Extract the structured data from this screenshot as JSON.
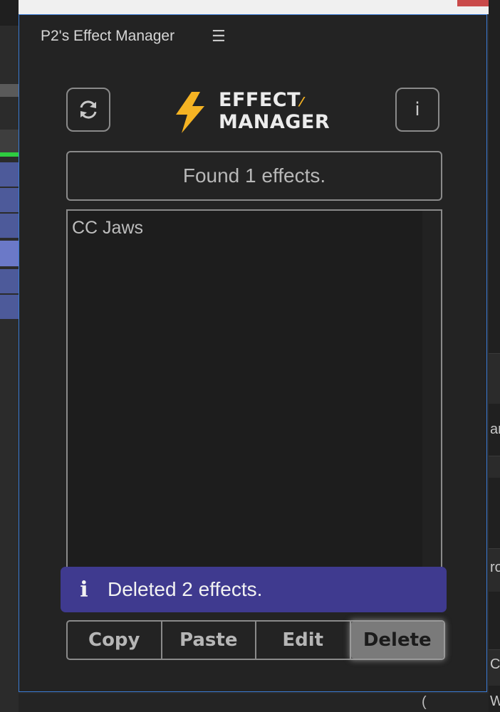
{
  "panel": {
    "title": "P2's Effect Manager",
    "menu_icon": "hamburger-icon",
    "border_color": "#3a7bd5"
  },
  "header": {
    "refresh_icon": "refresh-icon",
    "info_label": "i",
    "logo": {
      "line1": "EFFECT",
      "line2": "MANAGER",
      "accent_color": "#f5b323"
    }
  },
  "status": {
    "text": "Found 1 effects."
  },
  "effects_list": {
    "items": [
      "CC Jaws"
    ]
  },
  "toast": {
    "icon": "info-icon",
    "icon_glyph": "i",
    "message": "Deleted 2 effects.",
    "color": "#3f3a8f"
  },
  "actions": {
    "copy": "Copy",
    "paste": "Paste",
    "edit": "Edit",
    "delete": "Delete"
  },
  "background": {
    "right_fragments": [
      "ar",
      "ro",
      "Co",
      "W"
    ],
    "bottom_fragment": "("
  }
}
